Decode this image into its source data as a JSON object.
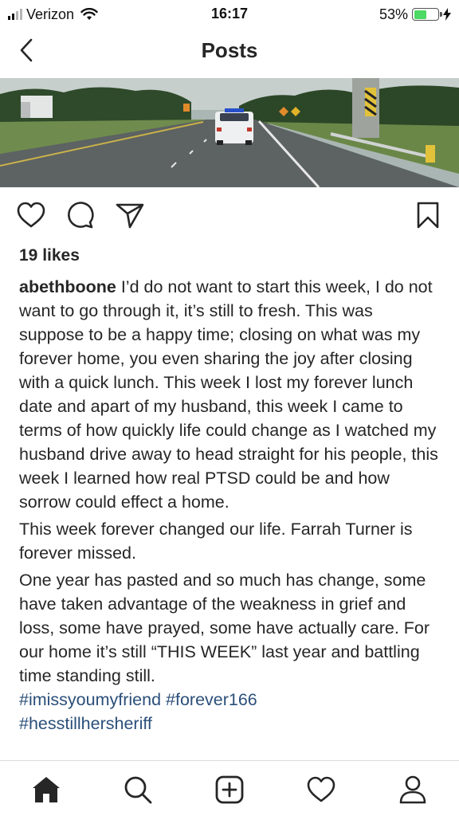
{
  "status_bar": {
    "carrier": "Verizon",
    "time": "16:17",
    "battery_percent": "53%",
    "battery_level": 0.53,
    "signal_bars": 2,
    "signal_total": 4,
    "icons": [
      "signal-icon",
      "wifi-icon",
      "battery-icon",
      "charging-bolt-icon"
    ]
  },
  "header": {
    "title": "Posts",
    "back_icon": "chevron-left-icon"
  },
  "post": {
    "actions": [
      "heart-icon",
      "comment-icon",
      "share-icon",
      "bookmark-icon"
    ],
    "likes": "19 likes",
    "username": "abethboone",
    "caption_p1_rest": " I’d do not want to start this week, I do not want  to go through it, it’s still to fresh. This was suppose to be a happy time; closing on what was my forever home, you even sharing the joy after closing with a quick lunch. This week I lost my forever lunch date and apart of my husband, this week I came to terms of how quickly life could change as I watched my husband drive away to head straight for his people, this week I learned  how real PTSD could be and how sorrow could effect a home.",
    "caption_p2": "This week forever changed our life. Farrah Turner is forever missed.",
    "caption_p3": "One year has pasted and so much has change, some have taken advantage of the weakness in grief and loss, some have prayed, some have actually care. For our home it’s still “THIS WEEK” last year and battling time standing still.",
    "hashtags": {
      "tag1": "#imissyoumyfriend",
      "tag2": "#forever166",
      "tag3": "#hesstillhersheriff"
    },
    "hashtag_color": "#2b4f7a"
  },
  "bottom_nav": {
    "tabs": [
      "home-icon",
      "search-icon",
      "add-post-icon",
      "activity-heart-icon",
      "profile-icon"
    ]
  }
}
